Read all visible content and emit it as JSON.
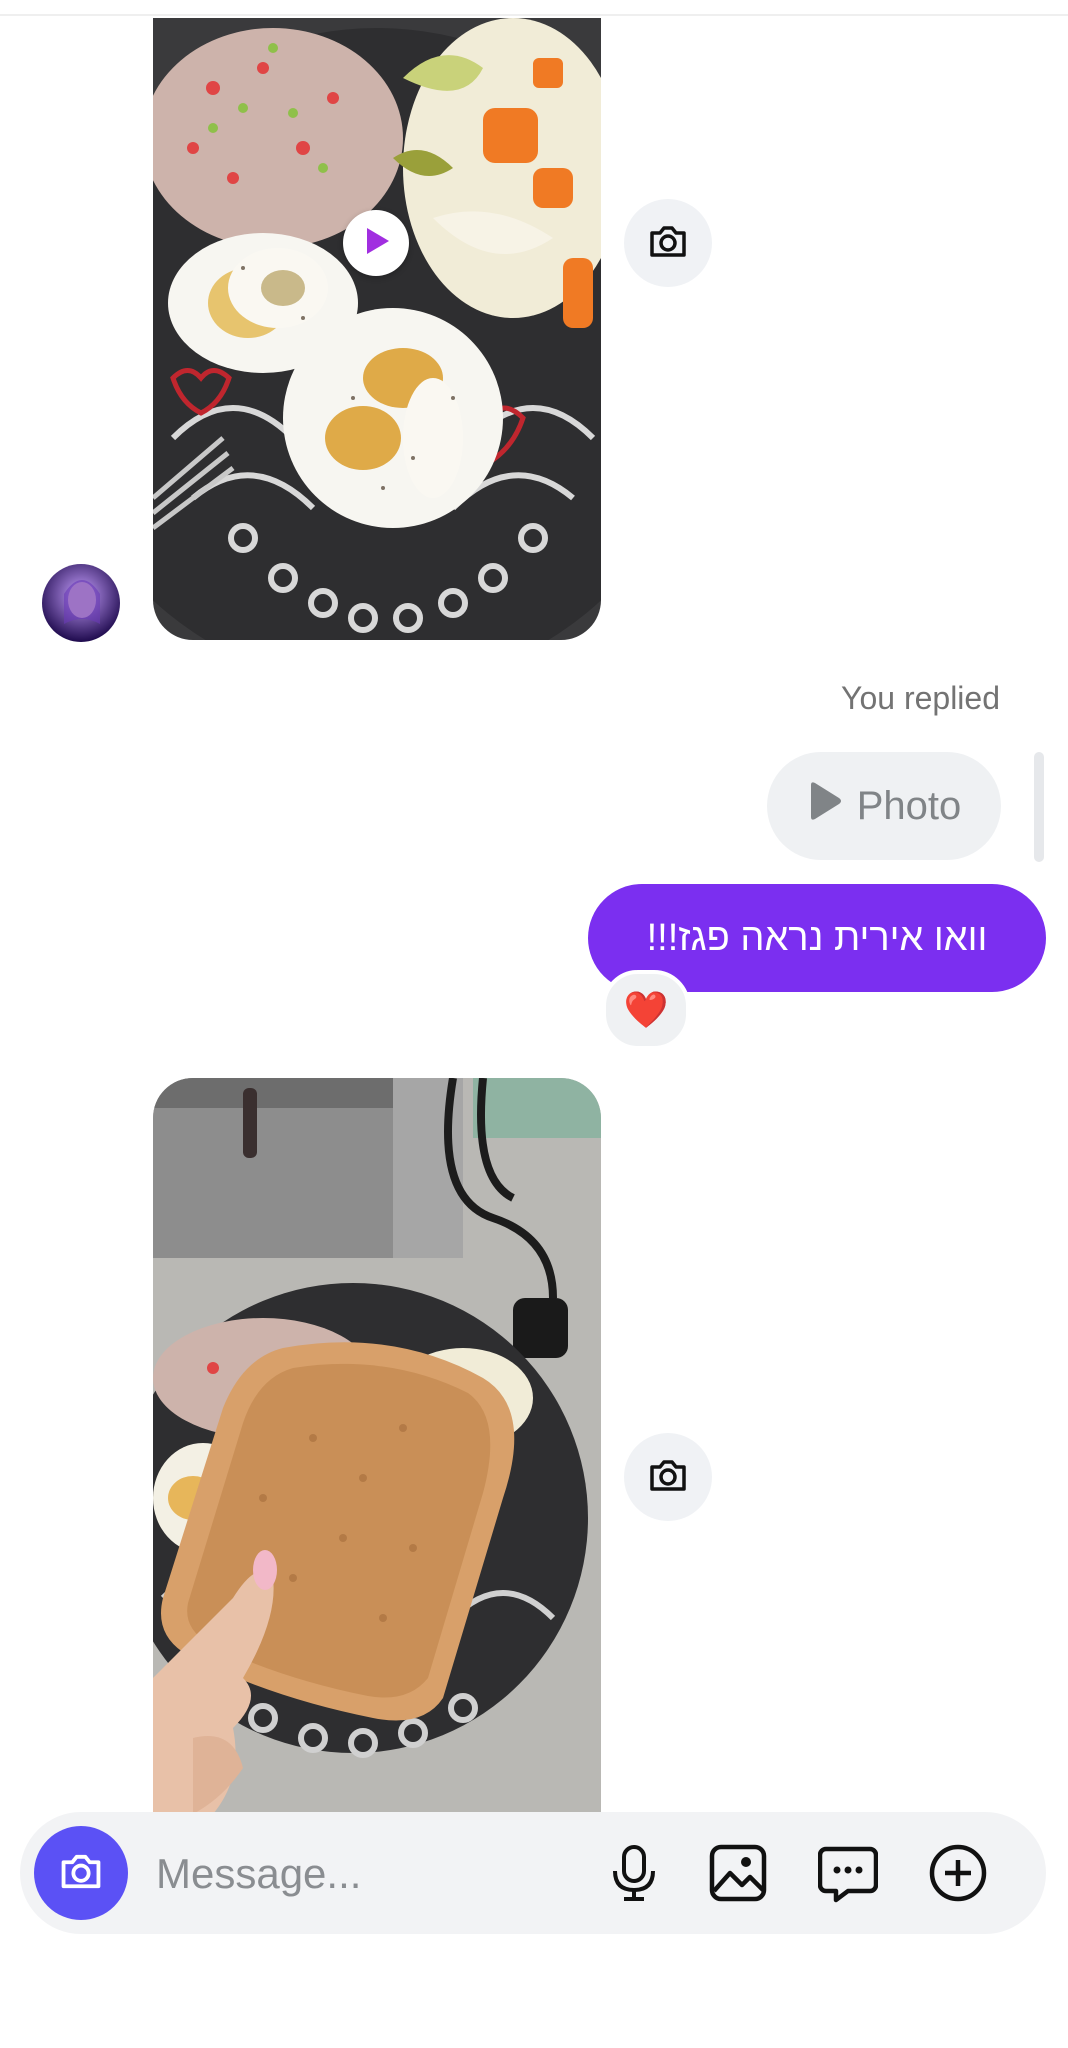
{
  "thread": {
    "replied_label": "You replied",
    "reply_preview_label": "Photo",
    "outgoing_message": "וואו אירית נראה פגז!!!",
    "reaction": "❤️"
  },
  "composer": {
    "placeholder": "Message..."
  },
  "icons": {
    "play": "play-icon",
    "camera": "camera-icon",
    "mic": "microphone-icon",
    "gallery": "gallery-icon",
    "sticker": "chat-sticker-icon",
    "plus": "plus-icon"
  },
  "colors": {
    "accent_purple": "#7b2ff0",
    "composer_camera": "#5b51f5",
    "pill_bg": "#eff1f3"
  }
}
